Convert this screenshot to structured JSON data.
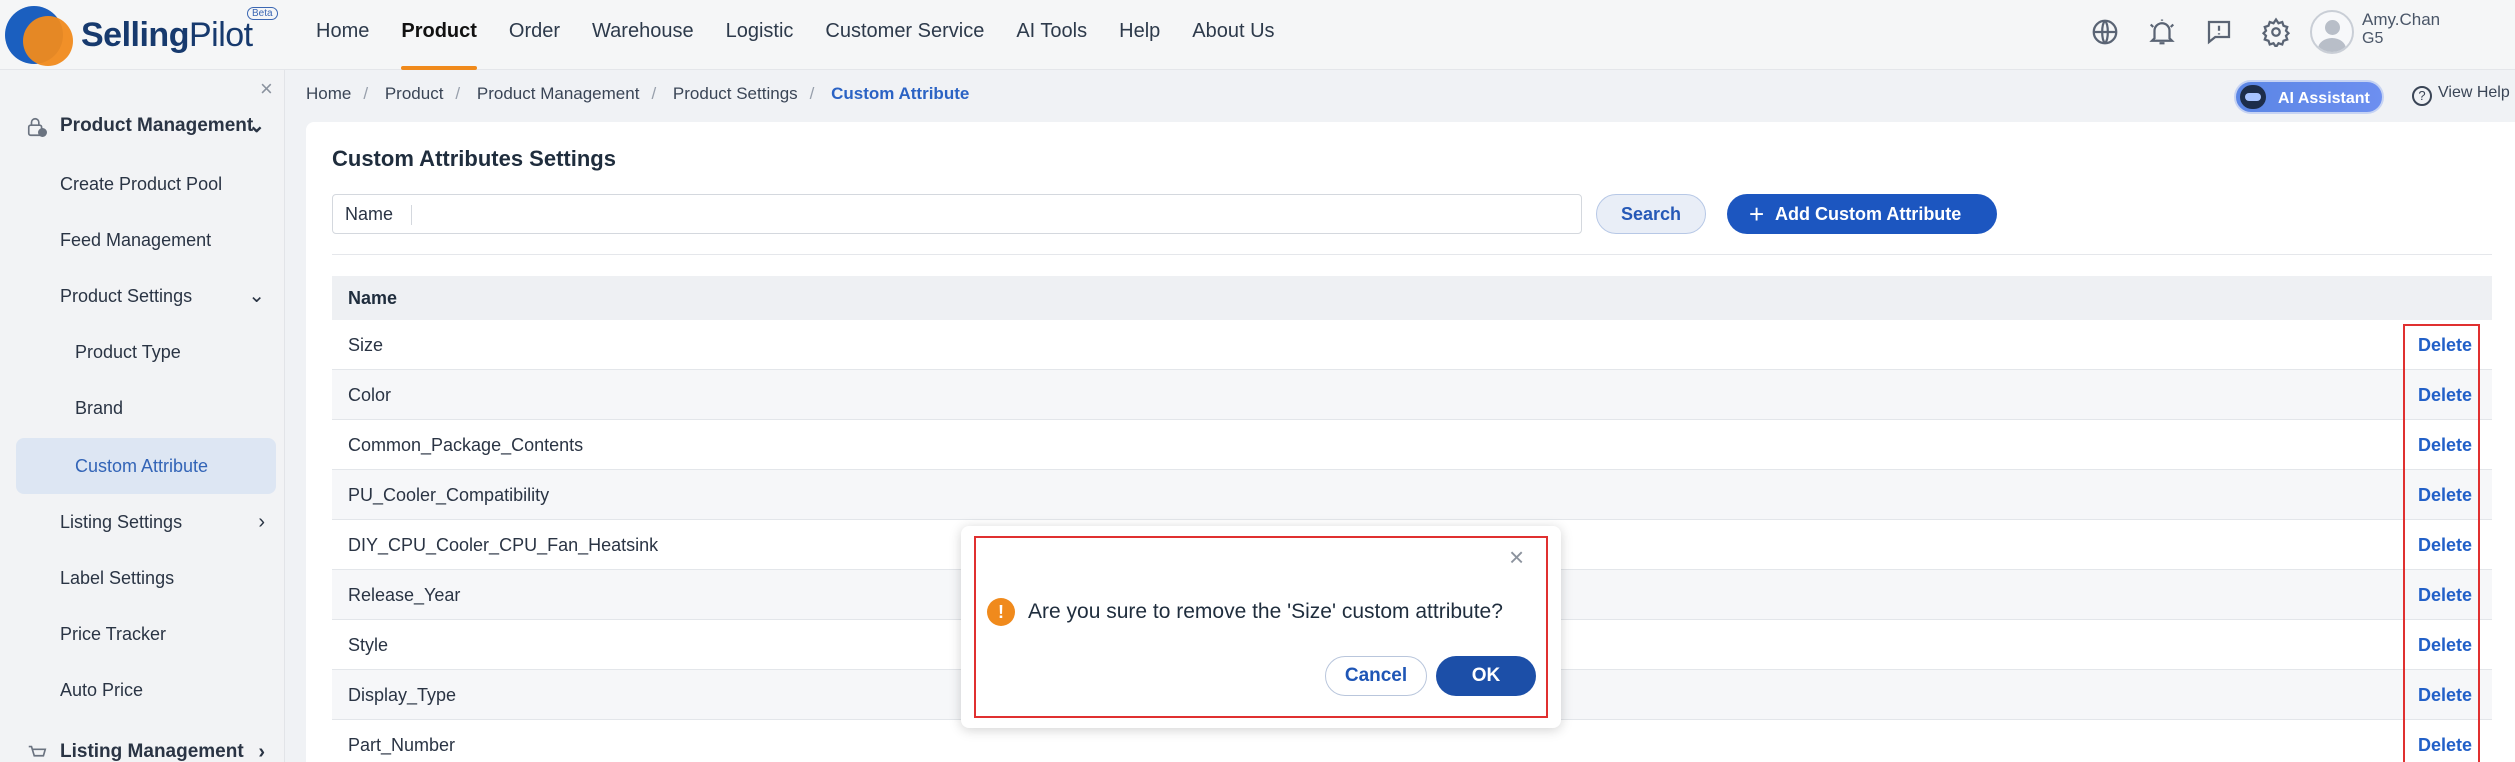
{
  "brand": {
    "name_part1": "Selling",
    "name_part2": "Pilot",
    "badge": "Beta"
  },
  "nav": {
    "items": [
      {
        "label": "Home"
      },
      {
        "label": "Product",
        "active": true
      },
      {
        "label": "Order"
      },
      {
        "label": "Warehouse"
      },
      {
        "label": "Logistic"
      },
      {
        "label": "Customer Service"
      },
      {
        "label": "AI Tools"
      },
      {
        "label": "Help"
      },
      {
        "label": "About Us"
      }
    ]
  },
  "header_icons": [
    "globe-icon",
    "bell-icon",
    "message-icon",
    "gear-icon"
  ],
  "user": {
    "name": "Amy.Chan",
    "org": "G5"
  },
  "sidebar": {
    "close_glyph": "×",
    "section1": "Product Management",
    "items": [
      {
        "label": "Create Product Pool"
      },
      {
        "label": "Feed Management"
      },
      {
        "label": "Product Settings"
      },
      {
        "label": "Product Type"
      },
      {
        "label": "Brand"
      },
      {
        "label": "Custom Attribute",
        "active": true
      },
      {
        "label": "Listing Settings"
      },
      {
        "label": "Label Settings"
      },
      {
        "label": "Price Tracker"
      },
      {
        "label": "Auto Price"
      }
    ],
    "section2": "Listing Management"
  },
  "breadcrumb": [
    "Home",
    "Product",
    "Product Management",
    "Product Settings",
    "Custom Attribute"
  ],
  "ai_assistant": {
    "label": "AI Assistant"
  },
  "view_help": {
    "label": "View Help"
  },
  "page": {
    "title": "Custom Attributes Settings",
    "search_label": "Name",
    "search_value": "",
    "search_button": "Search",
    "add_button": "Add Custom Attribute"
  },
  "table": {
    "header": "Name",
    "delete_label": "Delete",
    "rows": [
      "Size",
      "Color",
      "Common_Package_Contents",
      "PU_Cooler_Compatibility",
      "DIY_CPU_Cooler_CPU_Fan_Heatsink",
      "Release_Year",
      "Style",
      "Display_Type",
      "Part_Number"
    ]
  },
  "dialog": {
    "message": "Are you sure to remove the 'Size' custom attribute?",
    "warning_glyph": "!",
    "close_glyph": "×",
    "cancel": "Cancel",
    "ok": "OK"
  },
  "colors": {
    "accent": "#1c56c0",
    "brand_orange": "#f08a1c",
    "highlight": "#e03030"
  }
}
